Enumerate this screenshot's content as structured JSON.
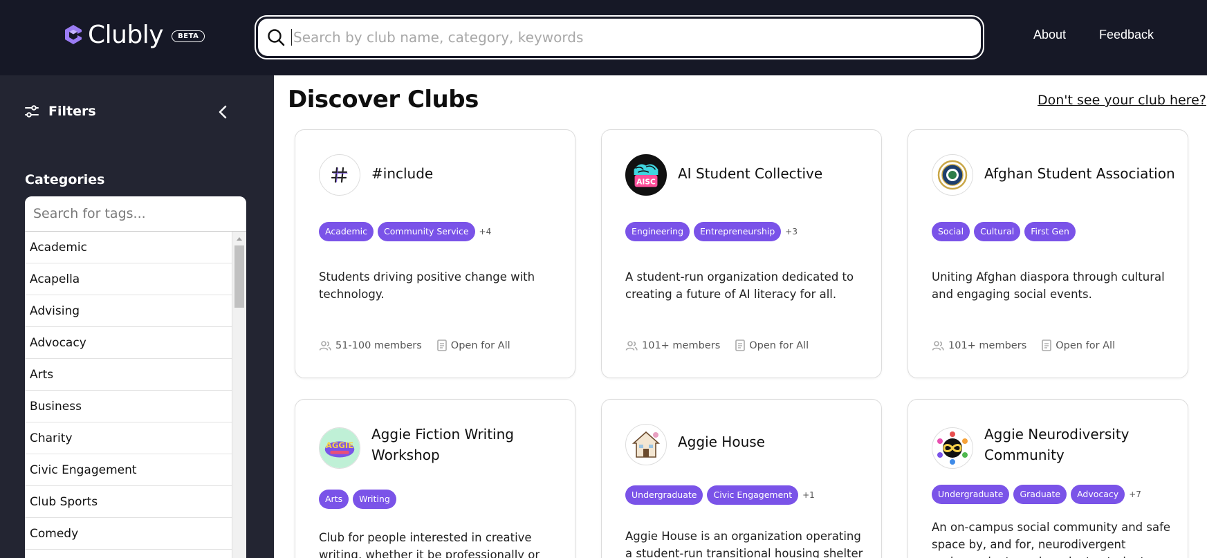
{
  "header": {
    "brand": "Clubly",
    "beta": "BETA",
    "search_placeholder": "Search by club name, category, keywords",
    "nav": [
      "About",
      "Feedback"
    ]
  },
  "sidebar": {
    "filters_label": "Filters",
    "categories_label": "Categories",
    "tag_search_placeholder": "Search for tags...",
    "categories": [
      "Academic",
      "Acapella",
      "Advising",
      "Advocacy",
      "Arts",
      "Business",
      "Charity",
      "Civic Engagement",
      "Club Sports",
      "Comedy"
    ]
  },
  "main": {
    "title": "Discover Clubs",
    "missing_link": "Don't see your club here?",
    "clubs": [
      {
        "name": "#include",
        "tags": [
          "Academic",
          "Community Service"
        ],
        "more": "+4",
        "description": "Students driving positive change with technology.",
        "members": "51-100 members",
        "access": "Open for All"
      },
      {
        "name": "AI Student Collective",
        "tags": [
          "Engineering",
          "Entrepreneurship"
        ],
        "more": "+3",
        "description": "A student-run organization dedicated to creating a future of AI literacy for all.",
        "members": "101+ members",
        "access": "Open for All"
      },
      {
        "name": "Afghan Student Association",
        "tags": [
          "Social",
          "Cultural",
          "First Gen"
        ],
        "more": "",
        "description": "Uniting Afghan diaspora through cultural and engaging social events.",
        "members": "101+ members",
        "access": "Open for All"
      },
      {
        "name": "Aggie Fiction Writing Workshop",
        "tags": [
          "Arts",
          "Writing"
        ],
        "more": "",
        "description": "Club for people interested in creative writing, whether it be professionally or just"
      },
      {
        "name": "Aggie House",
        "tags": [
          "Undergraduate",
          "Civic Engagement"
        ],
        "more": "+1",
        "description": "Aggie House is an organization operating a student-run transitional housing shelter"
      },
      {
        "name": "Aggie Neurodiversity Community",
        "tags": [
          "Undergraduate",
          "Graduate",
          "Advocacy"
        ],
        "more": "+7",
        "description": "An on-campus social community and safe space by, and for, neurodivergent undergraduate and graduate students"
      }
    ]
  },
  "colors": {
    "header_bg": "#161826",
    "sidebar_bg": "#232532",
    "tag_accent": "#7a53e8",
    "brand_mark": "#9b7cf5"
  }
}
